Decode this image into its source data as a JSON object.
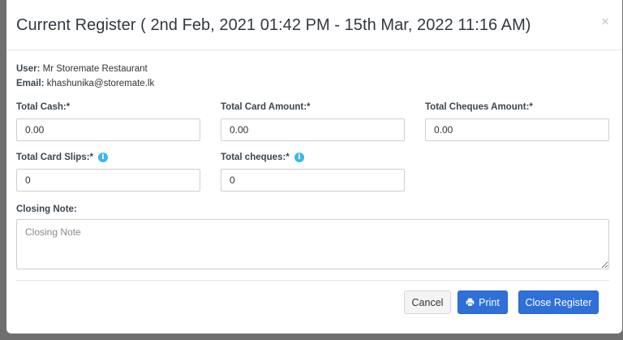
{
  "modal": {
    "title": "Current Register ( 2nd Feb, 2021 01:42 PM - 15th Mar, 2022 11:16 AM)",
    "close_icon": "×"
  },
  "user": {
    "user_label": "User:",
    "user_value": "Mr Storemate Restaurant",
    "email_label": "Email:",
    "email_value": "khashunika@storemate.lk"
  },
  "fields": {
    "total_cash": {
      "label": "Total Cash:*",
      "value": "0.00"
    },
    "total_card_amount": {
      "label": "Total Card Amount:*",
      "value": "0.00"
    },
    "total_cheques_amount": {
      "label": "Total Cheques Amount:*",
      "value": "0.00"
    },
    "total_card_slips": {
      "label": "Total Card Slips:*",
      "value": "0",
      "icon": "info-icon"
    },
    "total_cheques": {
      "label": "Total cheques:*",
      "value": "0",
      "icon": "info-icon"
    },
    "closing_note": {
      "label": "Closing Note:",
      "placeholder": "Closing Note",
      "value": ""
    }
  },
  "buttons": {
    "cancel": "Cancel",
    "print": "Print",
    "close_register": "Close Register"
  },
  "colors": {
    "primary": "#2e6fd8",
    "info": "#3fb6e8",
    "overlay": "#6f6f6f"
  }
}
